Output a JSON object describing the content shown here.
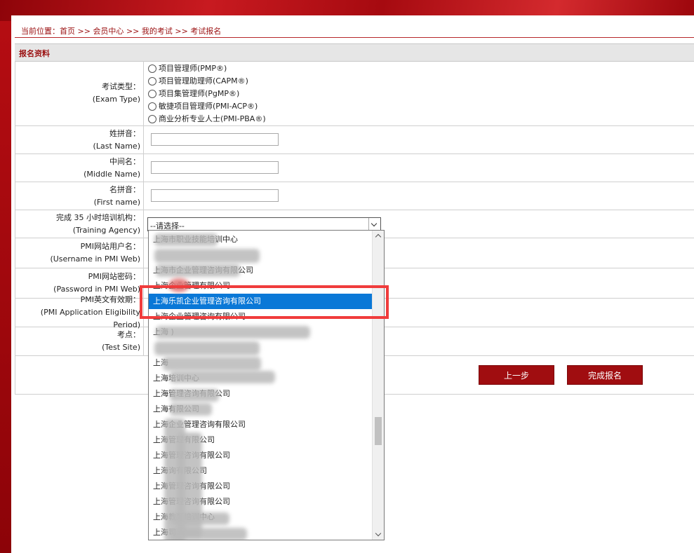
{
  "breadcrumb": {
    "prefix": "当前位置：",
    "items": [
      "首页",
      ">>",
      "会员中心",
      ">>",
      "我的考试",
      ">>",
      "考试报名"
    ]
  },
  "section_title": "报名资料",
  "exam_type": {
    "label_cn": "考试类型：",
    "label_en": "(Exam Type)",
    "options": [
      "项目管理师(PMP®)",
      "项目管理助理师(CAPM®)",
      "项目集管理师(PgMP®)",
      "敏捷项目管理师(PMI-ACP®)",
      "商业分析专业人士(PMI-PBA®)"
    ]
  },
  "last_name": {
    "label_cn": "姓拼音：",
    "label_en": "(Last Name)"
  },
  "middle_name": {
    "label_cn": "中间名：",
    "label_en": "(Middle Name)"
  },
  "first_name": {
    "label_cn": "名拼音：",
    "label_en": "(First name)"
  },
  "training_agency": {
    "label_cn": "完成 35 小时培训机构：",
    "label_en": "(Training Agency)",
    "selected": "--请选择--"
  },
  "pmi_username": {
    "label_cn": "PMI网站用户名：",
    "label_en": "(Username in PMI Web)"
  },
  "pmi_password": {
    "label_cn": "PMI网站密码：",
    "label_en": "(Password in PMI Web)"
  },
  "eligibility": {
    "label_cn": "PMI英文有效期：",
    "label_en": "(PMI Application Eligibility Period)"
  },
  "test_site": {
    "label_cn": "考点：",
    "label_en": "(Test Site)"
  },
  "dropdown": {
    "items": [
      "上海市职业技能培训中心",
      "",
      "上海市企业管理咨询有限公司",
      "上海企业管理有限公司",
      "上海乐凯企业管理咨询有限公司",
      "上海企业管理咨询有限公司",
      "上海 )",
      "",
      "上海",
      "上海培训中心",
      "上海管理咨询有限公司",
      "上海有限公司",
      "上海企业管理咨询有限公司",
      "上海管理有限公司",
      "上海管理咨询有限公司",
      "上海询有限公司",
      "上海管理咨询有限公司",
      "上海管理咨询有限公司",
      "上海教育培训中心",
      "上海司"
    ],
    "selected_index": 4
  },
  "buttons": {
    "prev": "上一步",
    "finish": "完成报名"
  },
  "colors": {
    "brand_red": "#a00d10",
    "selection_blue": "#0a78d7",
    "highlight_red": "#f03c3c"
  }
}
